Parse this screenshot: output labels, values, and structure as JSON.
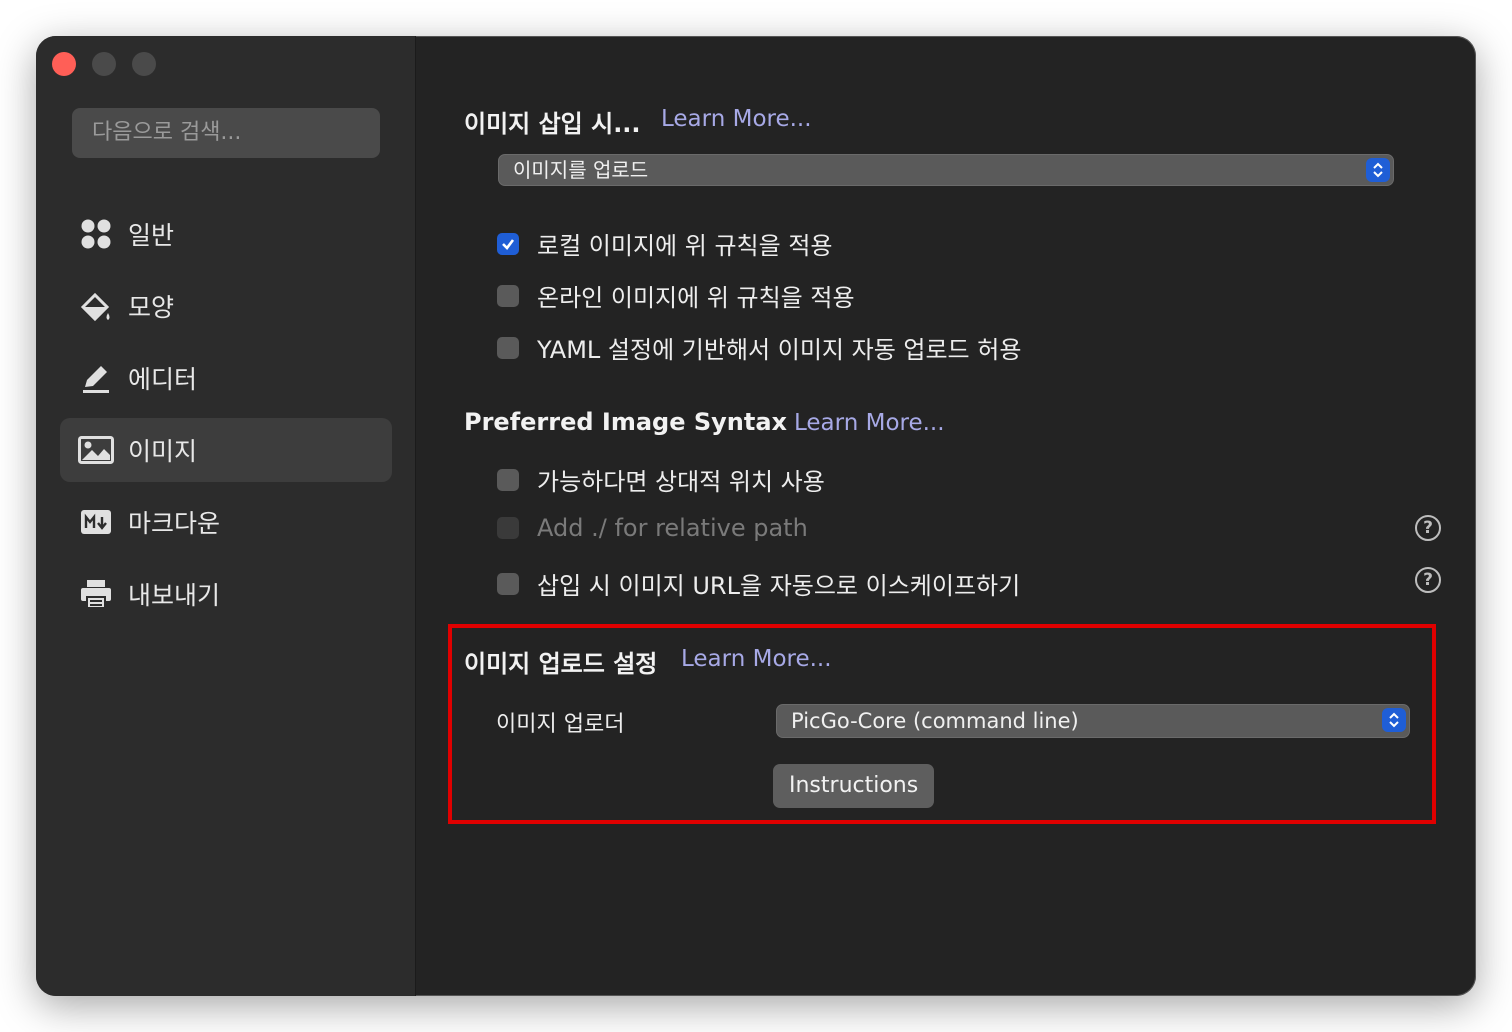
{
  "sidebar": {
    "search_placeholder": "다음으로 검색...",
    "items": [
      {
        "label": "일반",
        "icon": "grid-icon"
      },
      {
        "label": "모양",
        "icon": "paint-bucket-icon"
      },
      {
        "label": "에디터",
        "icon": "pencil-icon"
      },
      {
        "label": "이미지",
        "icon": "image-icon",
        "active": true
      },
      {
        "label": "마크다운",
        "icon": "markdown-icon"
      },
      {
        "label": "내보내기",
        "icon": "printer-icon"
      }
    ]
  },
  "insert_section": {
    "title": "이미지 삽입 시...",
    "learn_more": "Learn More...",
    "select_value": "이미지를 업로드",
    "options": [
      {
        "label": "로컬 이미지에 위 규칙을 적용",
        "checked": true
      },
      {
        "label": "온라인 이미지에 위 규칙을 적용",
        "checked": false
      },
      {
        "label": "YAML 설정에 기반해서 이미지 자동 업로드 허용",
        "checked": false
      }
    ]
  },
  "syntax_section": {
    "title": "Preferred Image Syntax",
    "learn_more": "Learn More...",
    "options": [
      {
        "label": "가능하다면 상대적 위치 사용",
        "checked": false
      },
      {
        "label": "Add ./ for relative path",
        "checked": false,
        "disabled": true
      },
      {
        "label": "삽입 시 이미지 URL을 자동으로 이스케이프하기",
        "checked": false
      }
    ],
    "help_glyph": "?"
  },
  "upload_section": {
    "title": "이미지 업로드 설정",
    "learn_more": "Learn More...",
    "uploader_label": "이미지 업로더",
    "uploader_value": "PicGo-Core (command line)",
    "instructions_button": "Instructions"
  },
  "colors": {
    "accent": "#1f5ed6",
    "link": "#a7a9e6",
    "highlight": "#e00000",
    "close": "#ff5f57"
  }
}
